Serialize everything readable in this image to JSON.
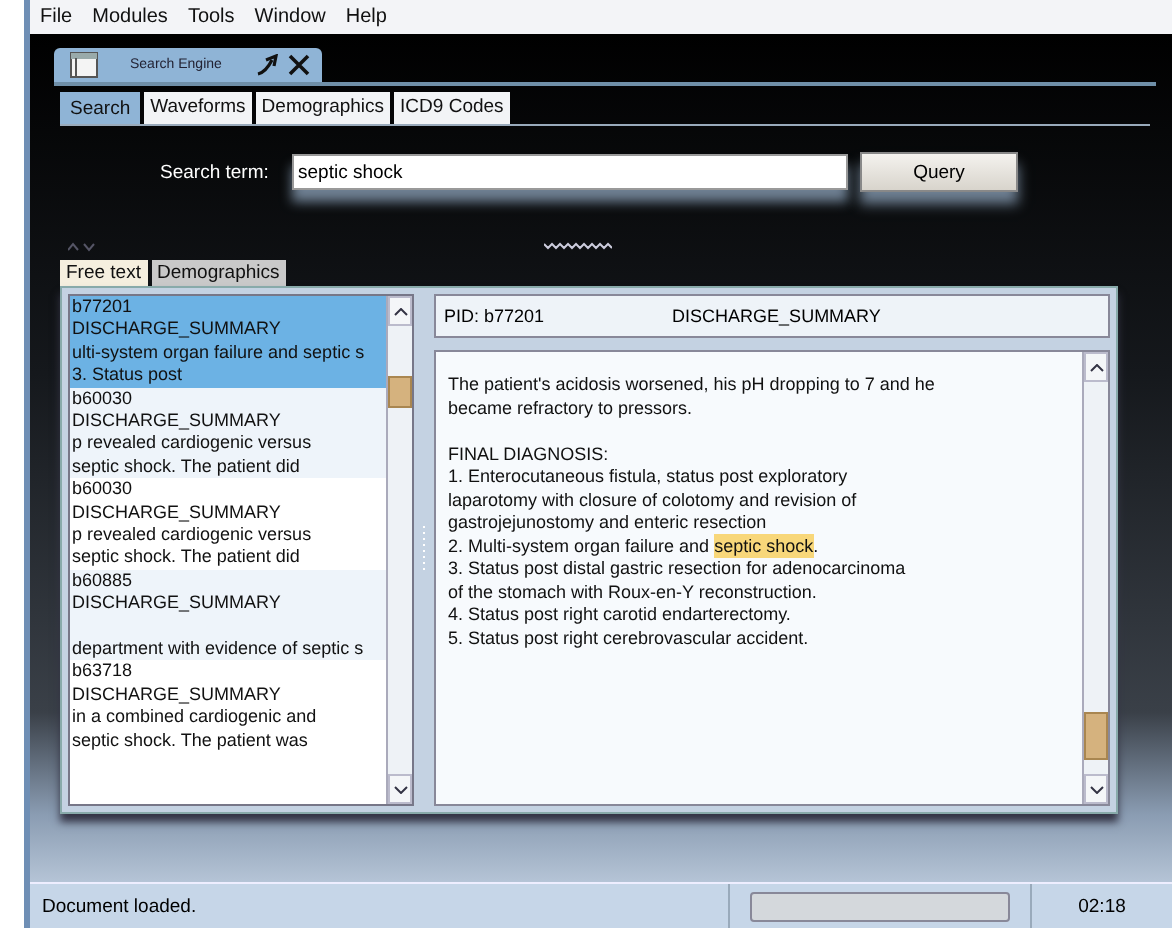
{
  "menu": [
    "File",
    "Modules",
    "Tools",
    "Window",
    "Help"
  ],
  "dock_tab": {
    "title": "Search Engine"
  },
  "tabs": [
    {
      "label": "Search",
      "selected": true
    },
    {
      "label": "Waveforms",
      "selected": false
    },
    {
      "label": "Demographics",
      "selected": false
    },
    {
      "label": "ICD9 Codes",
      "selected": false
    }
  ],
  "search": {
    "label": "Search term:",
    "value": "septic shock",
    "button": "Query"
  },
  "result_tabs": [
    {
      "label": "Free text",
      "selected": true
    },
    {
      "label": "Demographics",
      "selected": false
    }
  ],
  "results": [
    {
      "pid": "b77201",
      "type": "DISCHARGE_SUMMARY",
      "leading_blank": false,
      "snippet": [
        "ulti-system organ failure and septic s",
        "3.  Status post"
      ],
      "selected": true
    },
    {
      "pid": "b60030",
      "type": "DISCHARGE_SUMMARY",
      "leading_blank": false,
      "snippet": [
        "p revealed cardiogenic versus",
        "septic shock.  The patient did"
      ],
      "selected": false
    },
    {
      "pid": "b60030",
      "type": "DISCHARGE_SUMMARY",
      "leading_blank": false,
      "snippet": [
        "p revealed cardiogenic versus",
        "septic shock.  The patient did"
      ],
      "selected": false
    },
    {
      "pid": "b60885",
      "type": "DISCHARGE_SUMMARY",
      "leading_blank": true,
      "snippet": [
        "department with evidence of septic s"
      ],
      "selected": false
    },
    {
      "pid": "b63718",
      "type": "DISCHARGE_SUMMARY",
      "leading_blank": false,
      "snippet": [
        "in a combined cardiogenic and",
        "septic shock.  The patient was"
      ],
      "selected": false
    }
  ],
  "document": {
    "pid": "PID: b77201",
    "type": "DISCHARGE_SUMMARY",
    "paragraphs": [
      {
        "lines": [
          [
            {
              "text": "The patient's acidosis worsened, his pH dropping to 7 and he",
              "highlight": false
            }
          ],
          [
            {
              "text": "became refractory to pressors.",
              "highlight": false
            }
          ]
        ]
      },
      {
        "lines": [
          [
            {
              "text": "FINAL DIAGNOSIS:",
              "highlight": false
            }
          ],
          [
            {
              "text": "1.  Enterocutaneous fistula, status post exploratory",
              "highlight": false
            }
          ],
          [
            {
              "text": "laparotomy with closure of colotomy and revision of",
              "highlight": false
            }
          ],
          [
            {
              "text": "gastrojejunostomy and enteric resection",
              "highlight": false
            }
          ],
          [
            {
              "text": "2.  Multi-system organ failure and ",
              "highlight": false
            },
            {
              "text": "septic shock",
              "highlight": true
            },
            {
              "text": ".",
              "highlight": false
            }
          ],
          [
            {
              "text": "3.  Status post distal gastric resection for adenocarcinoma",
              "highlight": false
            }
          ],
          [
            {
              "text": "of the stomach with Roux-en-Y reconstruction.",
              "highlight": false
            }
          ],
          [
            {
              "text": "4.  Status post right carotid endarterectomy.",
              "highlight": false
            }
          ],
          [
            {
              "text": "5.  Status post right cerebrovascular accident.",
              "highlight": false
            }
          ]
        ]
      }
    ]
  },
  "status_bar": {
    "message": "Document loaded.",
    "progress": {
      "level": 0
    },
    "time": "02:18"
  }
}
